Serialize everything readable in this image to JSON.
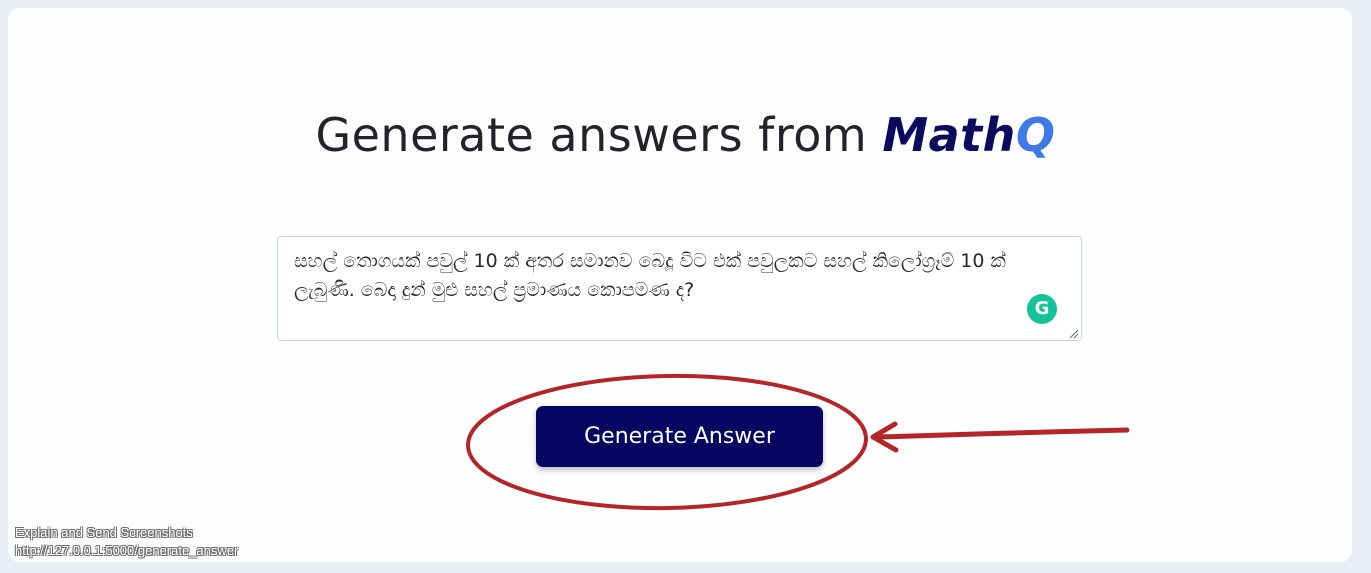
{
  "header": {
    "title_prefix": "Generate answers from ",
    "brand_main": "Math",
    "brand_q": "Q"
  },
  "question": {
    "value": "සහල් තොගයක් පවුල් 10 ක් අතර සමානව බෙදූ විට එක් පවුලකට සහල් කිලෝග්‍රෑම් 10 ක් ලැබුණි. බෙදා දුන් මුළු සහල් ප්‍රමාණය කොපමණ ද?"
  },
  "grammarly_icon": {
    "glyph": "G",
    "color": "#15c39a"
  },
  "actions": {
    "generate_label": "Generate Answer"
  },
  "annotation": {
    "color": "#b52427"
  },
  "overlay": {
    "line1": "Explain and Send Screenshots",
    "line2": "http://127.0.0.1:5000/generate_answer"
  },
  "colors": {
    "background": "#e9eef5",
    "card": "#fdfeff",
    "brand_main": "#0b0a5e",
    "brand_q": "#3f79e8",
    "button": "#060561"
  }
}
